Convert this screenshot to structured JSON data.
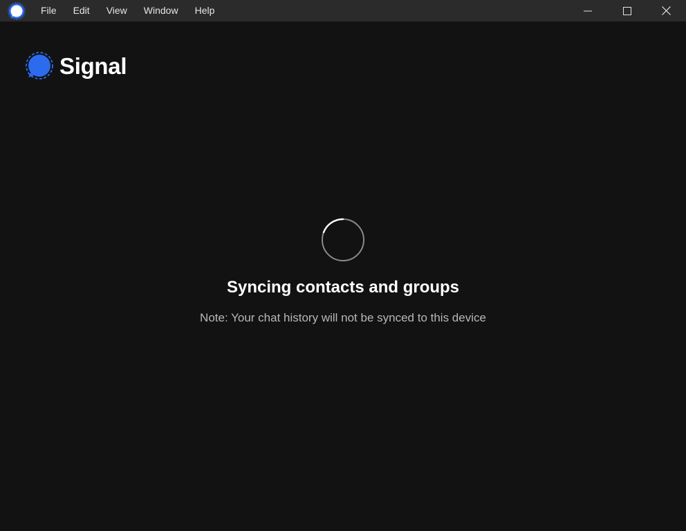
{
  "window": {
    "menu": [
      "File",
      "Edit",
      "View",
      "Window",
      "Help"
    ],
    "controls": {
      "minimize": "minimize-icon",
      "maximize": "maximize-icon",
      "close": "close-icon"
    }
  },
  "brand": {
    "name": "Signal",
    "icon": "signal-logo-icon",
    "color": "#2c6bed"
  },
  "sync": {
    "title": "Syncing contacts and groups",
    "note": "Note: Your chat history will not be synced to this device",
    "spinner_icon": "loading-spinner-icon"
  }
}
